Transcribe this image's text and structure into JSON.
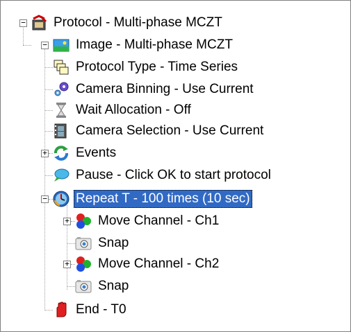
{
  "colors": {
    "selection": "#316ac5",
    "tree_lines": "#a0a0a0"
  },
  "tree": {
    "root": {
      "label": "Protocol - Multi-phase MCZT",
      "icon": "protocol-run-icon",
      "expander": "−"
    },
    "image": {
      "label": "Image - Multi-phase MCZT",
      "icon": "image-landscape-icon",
      "expander": "−"
    },
    "protocol_type": {
      "label": "Protocol Type - Time Series",
      "icon": "stacked-frames-icon"
    },
    "camera_binning": {
      "label": "Camera Binning - Use Current",
      "icon": "gears-icon"
    },
    "wait_allocation": {
      "label": "Wait Allocation - Off",
      "icon": "hourglass-icon"
    },
    "camera_selection": {
      "label": "Camera Selection - Use Current",
      "icon": "film-camera-icon"
    },
    "events": {
      "label": "Events",
      "icon": "refresh-arrows-icon",
      "expander": "+"
    },
    "pause": {
      "label": "Pause - Click OK to start protocol",
      "icon": "chat-bubble-icon"
    },
    "repeat": {
      "label": "Repeat T - 100 times (10 sec)",
      "icon": "clock-icon",
      "expander": "−",
      "selected": true
    },
    "move_ch1": {
      "label": "Move Channel - Ch1",
      "icon": "rgb-channels-icon",
      "expander": "+"
    },
    "snap1": {
      "label": "Snap",
      "icon": "camera-snap-icon"
    },
    "move_ch2": {
      "label": "Move Channel - Ch2",
      "icon": "rgb-channels-icon",
      "expander": "+"
    },
    "snap2": {
      "label": "Snap",
      "icon": "camera-snap-icon"
    },
    "end": {
      "label": "End - T0",
      "icon": "stop-hand-icon"
    }
  }
}
